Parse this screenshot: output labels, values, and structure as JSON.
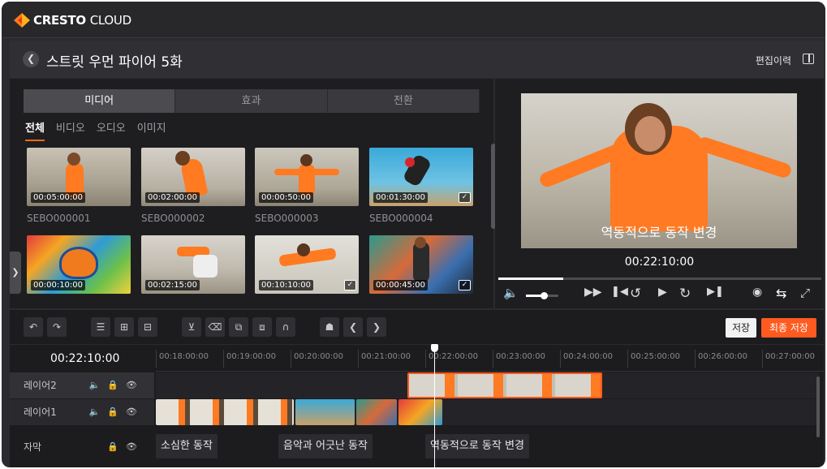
{
  "brand": {
    "bold": "CRESTO",
    "thin": "CLOUD"
  },
  "header": {
    "title": "스트릿 우먼 파이어 5화",
    "history_label": "편집이력"
  },
  "media": {
    "tabs": [
      {
        "label": "미디어"
      },
      {
        "label": "효과"
      },
      {
        "label": "전환"
      }
    ],
    "subtabs": [
      {
        "label": "전체"
      },
      {
        "label": "비디오"
      },
      {
        "label": "오디오"
      },
      {
        "label": "이미지"
      }
    ],
    "items": [
      {
        "duration": "00:05:00:00",
        "name": "SEBO000001",
        "checked": false
      },
      {
        "duration": "00:02:00:00",
        "name": "SEBO000002",
        "checked": false
      },
      {
        "duration": "00:00:50:00",
        "name": "SEBO000003",
        "checked": false
      },
      {
        "duration": "00:01:30:00",
        "name": "SEBO000004",
        "checked": true
      },
      {
        "duration": "00:00:10:00",
        "name": "",
        "checked": false
      },
      {
        "duration": "00:02:15:00",
        "name": "",
        "checked": false
      },
      {
        "duration": "00:10:10:00",
        "name": "",
        "checked": true
      },
      {
        "duration": "00:00:45:00",
        "name": "",
        "checked": true
      }
    ]
  },
  "preview": {
    "caption": "역동적으로 동작 변경",
    "timecode": "00:22:10:00",
    "progress": 0.2,
    "volume": 0.55
  },
  "toolbar": {
    "save_label": "저장",
    "final_save_label": "최종 저장"
  },
  "timeline": {
    "current_time": "00:22:10:00",
    "ruler": [
      "00:18:00:00",
      "00:19:00:00",
      "00:20:00:00",
      "00:21:00:00",
      "00:22:00:00",
      "00:23:00:00",
      "00:24:00:00",
      "00:25:00:00",
      "00:26:00:00",
      "00:27:00:00"
    ],
    "tracks": [
      {
        "label": "레이어2"
      },
      {
        "label": "레이어1"
      },
      {
        "label": "자막"
      }
    ],
    "subtitles": [
      {
        "text": "소심한 동작"
      },
      {
        "text": "음악과 어긋난 동작"
      },
      {
        "text": "역동적으로 동작 변경"
      }
    ]
  },
  "colors": {
    "accent": "#ff5a1f",
    "background": "#2b2b2f",
    "panel": "#1e1e21"
  }
}
